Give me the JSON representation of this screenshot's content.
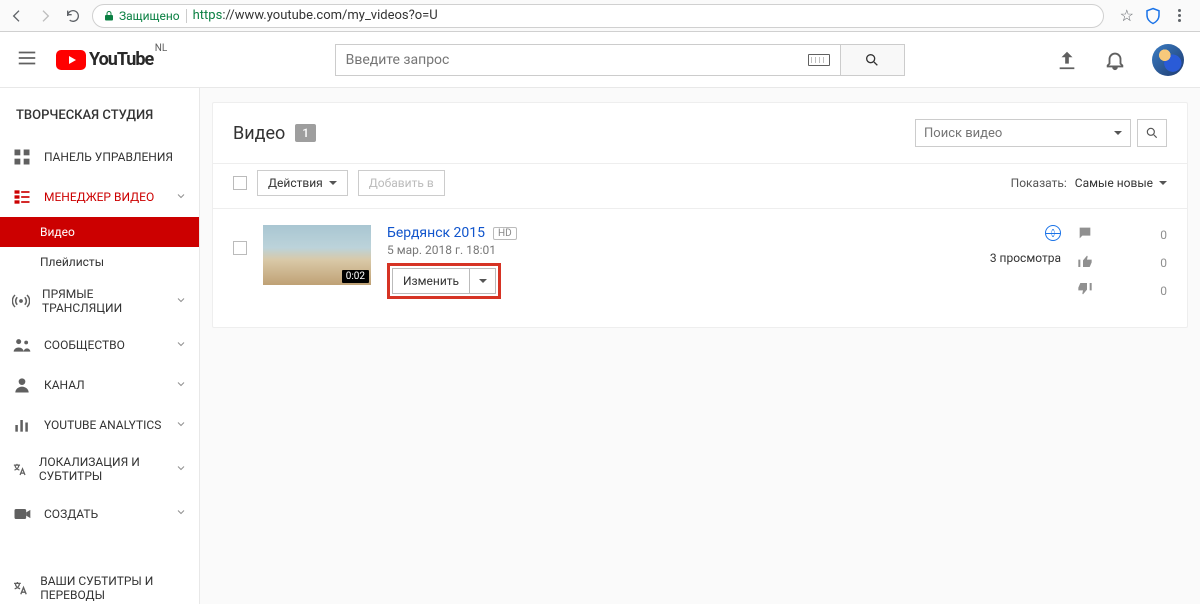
{
  "chrome": {
    "secure_label": "Защищено",
    "url_proto": "https",
    "url_rest": "://www.youtube.com/my_videos?o=U"
  },
  "mast": {
    "logo_text": "YouTube",
    "country": "NL",
    "search_placeholder": "Введите запрос"
  },
  "sidebar": {
    "heading": "ТВОРЧЕСКАЯ СТУДИЯ",
    "items": [
      {
        "label": "ПАНЕЛЬ УПРАВЛЕНИЯ"
      },
      {
        "label": "МЕНЕДЖЕР ВИДЕО",
        "sub_videos": "Видео",
        "sub_play": "Плейлисты"
      },
      {
        "label": "ПРЯМЫЕ ТРАНСЛЯЦИИ"
      },
      {
        "label": "СООБЩЕСТВО"
      },
      {
        "label": "КАНАЛ"
      },
      {
        "label": "YOUTUBE ANALYTICS"
      },
      {
        "label": "ЛОКАЛИЗАЦИЯ И СУБТИТРЫ"
      },
      {
        "label": "СОЗДАТЬ"
      },
      {
        "label": "ВАШИ СУБТИТРЫ И ПЕРЕВОДЫ"
      }
    ]
  },
  "main": {
    "title": "Видео",
    "count": "1",
    "search_placeholder": "Поиск видео",
    "actions_label": "Действия",
    "addto_label": "Добавить в",
    "show_label": "Показать:",
    "sort_label": "Самые новые"
  },
  "video": {
    "title": "Бердянск 2015",
    "hd": "HD",
    "date": "5 мар. 2018 г. 18:01",
    "edit_label": "Изменить",
    "duration": "0:02",
    "views": "3 просмотра",
    "comments": "0",
    "likes": "0",
    "dislikes": "0"
  }
}
